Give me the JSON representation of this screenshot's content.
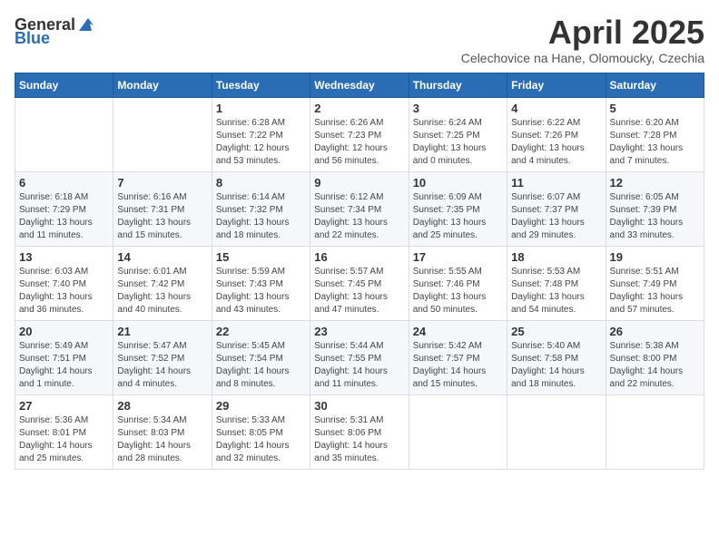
{
  "logo": {
    "text_general": "General",
    "text_blue": "Blue"
  },
  "title": "April 2025",
  "subtitle": "Celechovice na Hane, Olomoucky, Czechia",
  "days_of_week": [
    "Sunday",
    "Monday",
    "Tuesday",
    "Wednesday",
    "Thursday",
    "Friday",
    "Saturday"
  ],
  "weeks": [
    [
      {
        "day": "",
        "sunrise": "",
        "sunset": "",
        "daylight": ""
      },
      {
        "day": "",
        "sunrise": "",
        "sunset": "",
        "daylight": ""
      },
      {
        "day": "1",
        "sunrise": "Sunrise: 6:28 AM",
        "sunset": "Sunset: 7:22 PM",
        "daylight": "Daylight: 12 hours and 53 minutes."
      },
      {
        "day": "2",
        "sunrise": "Sunrise: 6:26 AM",
        "sunset": "Sunset: 7:23 PM",
        "daylight": "Daylight: 12 hours and 56 minutes."
      },
      {
        "day": "3",
        "sunrise": "Sunrise: 6:24 AM",
        "sunset": "Sunset: 7:25 PM",
        "daylight": "Daylight: 13 hours and 0 minutes."
      },
      {
        "day": "4",
        "sunrise": "Sunrise: 6:22 AM",
        "sunset": "Sunset: 7:26 PM",
        "daylight": "Daylight: 13 hours and 4 minutes."
      },
      {
        "day": "5",
        "sunrise": "Sunrise: 6:20 AM",
        "sunset": "Sunset: 7:28 PM",
        "daylight": "Daylight: 13 hours and 7 minutes."
      }
    ],
    [
      {
        "day": "6",
        "sunrise": "Sunrise: 6:18 AM",
        "sunset": "Sunset: 7:29 PM",
        "daylight": "Daylight: 13 hours and 11 minutes."
      },
      {
        "day": "7",
        "sunrise": "Sunrise: 6:16 AM",
        "sunset": "Sunset: 7:31 PM",
        "daylight": "Daylight: 13 hours and 15 minutes."
      },
      {
        "day": "8",
        "sunrise": "Sunrise: 6:14 AM",
        "sunset": "Sunset: 7:32 PM",
        "daylight": "Daylight: 13 hours and 18 minutes."
      },
      {
        "day": "9",
        "sunrise": "Sunrise: 6:12 AM",
        "sunset": "Sunset: 7:34 PM",
        "daylight": "Daylight: 13 hours and 22 minutes."
      },
      {
        "day": "10",
        "sunrise": "Sunrise: 6:09 AM",
        "sunset": "Sunset: 7:35 PM",
        "daylight": "Daylight: 13 hours and 25 minutes."
      },
      {
        "day": "11",
        "sunrise": "Sunrise: 6:07 AM",
        "sunset": "Sunset: 7:37 PM",
        "daylight": "Daylight: 13 hours and 29 minutes."
      },
      {
        "day": "12",
        "sunrise": "Sunrise: 6:05 AM",
        "sunset": "Sunset: 7:39 PM",
        "daylight": "Daylight: 13 hours and 33 minutes."
      }
    ],
    [
      {
        "day": "13",
        "sunrise": "Sunrise: 6:03 AM",
        "sunset": "Sunset: 7:40 PM",
        "daylight": "Daylight: 13 hours and 36 minutes."
      },
      {
        "day": "14",
        "sunrise": "Sunrise: 6:01 AM",
        "sunset": "Sunset: 7:42 PM",
        "daylight": "Daylight: 13 hours and 40 minutes."
      },
      {
        "day": "15",
        "sunrise": "Sunrise: 5:59 AM",
        "sunset": "Sunset: 7:43 PM",
        "daylight": "Daylight: 13 hours and 43 minutes."
      },
      {
        "day": "16",
        "sunrise": "Sunrise: 5:57 AM",
        "sunset": "Sunset: 7:45 PM",
        "daylight": "Daylight: 13 hours and 47 minutes."
      },
      {
        "day": "17",
        "sunrise": "Sunrise: 5:55 AM",
        "sunset": "Sunset: 7:46 PM",
        "daylight": "Daylight: 13 hours and 50 minutes."
      },
      {
        "day": "18",
        "sunrise": "Sunrise: 5:53 AM",
        "sunset": "Sunset: 7:48 PM",
        "daylight": "Daylight: 13 hours and 54 minutes."
      },
      {
        "day": "19",
        "sunrise": "Sunrise: 5:51 AM",
        "sunset": "Sunset: 7:49 PM",
        "daylight": "Daylight: 13 hours and 57 minutes."
      }
    ],
    [
      {
        "day": "20",
        "sunrise": "Sunrise: 5:49 AM",
        "sunset": "Sunset: 7:51 PM",
        "daylight": "Daylight: 14 hours and 1 minute."
      },
      {
        "day": "21",
        "sunrise": "Sunrise: 5:47 AM",
        "sunset": "Sunset: 7:52 PM",
        "daylight": "Daylight: 14 hours and 4 minutes."
      },
      {
        "day": "22",
        "sunrise": "Sunrise: 5:45 AM",
        "sunset": "Sunset: 7:54 PM",
        "daylight": "Daylight: 14 hours and 8 minutes."
      },
      {
        "day": "23",
        "sunrise": "Sunrise: 5:44 AM",
        "sunset": "Sunset: 7:55 PM",
        "daylight": "Daylight: 14 hours and 11 minutes."
      },
      {
        "day": "24",
        "sunrise": "Sunrise: 5:42 AM",
        "sunset": "Sunset: 7:57 PM",
        "daylight": "Daylight: 14 hours and 15 minutes."
      },
      {
        "day": "25",
        "sunrise": "Sunrise: 5:40 AM",
        "sunset": "Sunset: 7:58 PM",
        "daylight": "Daylight: 14 hours and 18 minutes."
      },
      {
        "day": "26",
        "sunrise": "Sunrise: 5:38 AM",
        "sunset": "Sunset: 8:00 PM",
        "daylight": "Daylight: 14 hours and 22 minutes."
      }
    ],
    [
      {
        "day": "27",
        "sunrise": "Sunrise: 5:36 AM",
        "sunset": "Sunset: 8:01 PM",
        "daylight": "Daylight: 14 hours and 25 minutes."
      },
      {
        "day": "28",
        "sunrise": "Sunrise: 5:34 AM",
        "sunset": "Sunset: 8:03 PM",
        "daylight": "Daylight: 14 hours and 28 minutes."
      },
      {
        "day": "29",
        "sunrise": "Sunrise: 5:33 AM",
        "sunset": "Sunset: 8:05 PM",
        "daylight": "Daylight: 14 hours and 32 minutes."
      },
      {
        "day": "30",
        "sunrise": "Sunrise: 5:31 AM",
        "sunset": "Sunset: 8:06 PM",
        "daylight": "Daylight: 14 hours and 35 minutes."
      },
      {
        "day": "",
        "sunrise": "",
        "sunset": "",
        "daylight": ""
      },
      {
        "day": "",
        "sunrise": "",
        "sunset": "",
        "daylight": ""
      },
      {
        "day": "",
        "sunrise": "",
        "sunset": "",
        "daylight": ""
      }
    ]
  ]
}
